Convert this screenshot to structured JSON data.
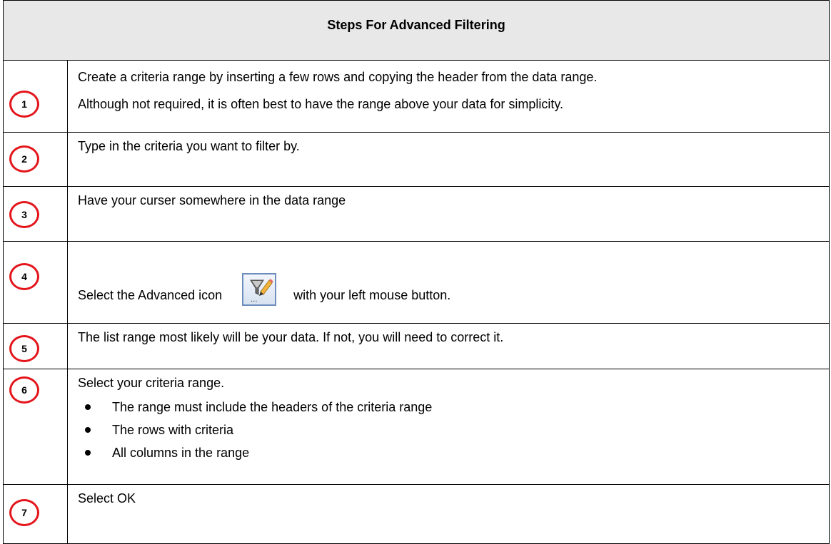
{
  "title": "Steps For Advanced Filtering",
  "steps": [
    {
      "number": "1",
      "lines": [
        "Create a criteria range by inserting a few rows and copying the header from the data range.",
        "Although not required, it is often best to have the range above your data for simplicity."
      ]
    },
    {
      "number": "2",
      "text": "Type in the criteria you want to filter by."
    },
    {
      "number": "3",
      "text": "Have your curser somewhere in the data range"
    },
    {
      "number": "4",
      "text_before": "Select the Advanced icon",
      "text_after": "with your left mouse button.",
      "icon": "advanced-filter-icon"
    },
    {
      "number": "5",
      "text": "The list range most likely will be your data. If not, you will need to correct it."
    },
    {
      "number": "6",
      "text": "Select your criteria range.",
      "bullets": [
        "The range must include the headers of the criteria range",
        "The rows with criteria",
        "All columns in the range"
      ]
    },
    {
      "number": "7",
      "text": "Select OK"
    }
  ],
  "colors": {
    "circle": "#e4141b",
    "header_bg": "#e8e8e8",
    "icon_border": "#6d8dbd"
  }
}
